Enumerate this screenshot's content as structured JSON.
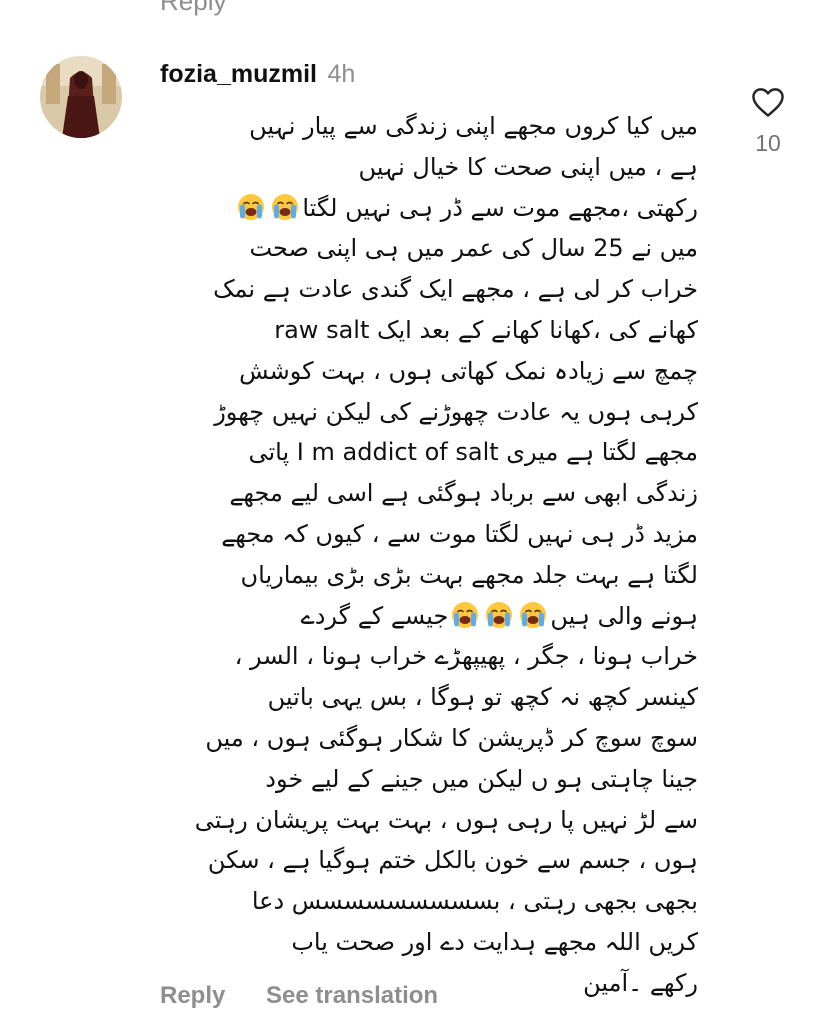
{
  "previous_comment": {
    "reply_label_cut": "Reply"
  },
  "comment": {
    "username": "fozia_muzmil",
    "time": "4h",
    "lines": [
      [
        "میں کیا کروں مجھے اپنی زندگی سے پیار نہیں"
      ],
      [
        "ہے ، میں اپنی صحت کا خیال نہیں"
      ],
      [
        "رکھتی ،مجھے موت سے ڈر ہی نہیں لگتا",
        "loudly-crying-face-emoji",
        "loudly-crying-face-emoji"
      ],
      [
        "میں نے 25 سال کی عمر میں ہی اپنی صحت"
      ],
      [
        "خراب کر لی ہے ، مجھے ایک گندی عادت ہے نمک"
      ],
      [
        "کھانے کی ،کھانا کھانے کے بعد ایک raw salt"
      ],
      [
        "چمچ سے زیادہ نمک کھاتی ہوں ، بہت کوشش"
      ],
      [
        "کرہی ہوں یہ عادت چھوڑنے کی لیکن نہیں چھوڑ"
      ],
      [
        "مجھے لگتا ہے میری I m addict of salt پاتی"
      ],
      [
        "زندگی ابھی سے برباد ہوگئی ہے اسی لیے مجھے"
      ],
      [
        "مزید ڈر ہی نہیں لگتا موت سے ، کیوں کہ مجھے"
      ],
      [
        "لگتا ہے بہت جلد مجھے بہت بڑی بڑی بیماریاں"
      ],
      [
        "ہونے والی ہیں",
        "loudly-crying-face-emoji",
        "loudly-crying-face-emoji",
        "loudly-crying-face-emoji",
        "جیسے کے گردے"
      ],
      [
        "خراب ہونا ، جگر ، پھیپھڑے خراب ہونا ، السر ،"
      ],
      [
        "کینسر کچھ نہ کچھ تو ہوگا ، بس یہی باتیں"
      ],
      [
        "سوچ سوچ کر ڈپریشن کا شکار ہوگئی ہوں ، میں"
      ],
      [
        "جینا چاہتی ہو ں لیکن میں جینے کے لیے خود"
      ],
      [
        "سے لڑ نہیں پا رہی ہوں ، بہت بہت پریشان رہتی"
      ],
      [
        "ہوں ، جسم سے خون بالکل ختم ہوگیا ہے ، سکن"
      ],
      [
        "بجھی بجھی رہتی ، بسسسسسسسسس دعا"
      ],
      [
        "کریں اللہ مجھے ہدایت دے اور صحت یاب"
      ],
      [
        "رکھے ۔آمین"
      ]
    ],
    "like_count": "10",
    "reply_label": "Reply",
    "translate_label": "See translation"
  },
  "icons": {
    "like": "heart-outline-icon",
    "emoji": "loudly-crying-face-emoji"
  },
  "colors": {
    "text": "#111111",
    "muted": "#8e8e8e",
    "like_count": "#737373",
    "emoji_face": "#FFC83D",
    "emoji_tears": "#5DADEC"
  }
}
